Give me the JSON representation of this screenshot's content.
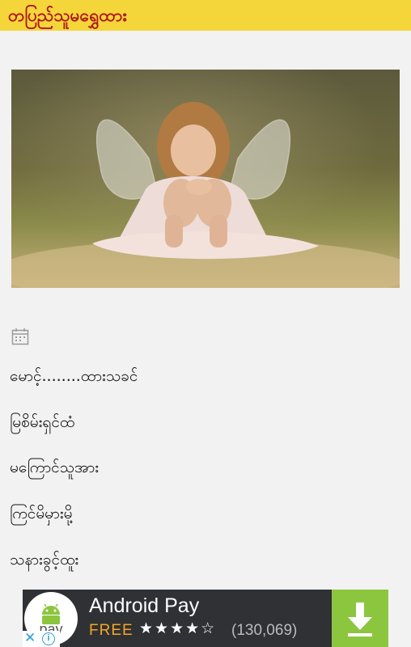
{
  "header": {
    "title": "တပြည်သူမရွှေထား"
  },
  "post": {
    "lines": [
      "မောင့်........ထားသခင်",
      "မြစိမ်းရှင်ထံ",
      "မကြောင်သူအား",
      "ကြင်မိမှားမို့",
      "သနားခွင့်ထူး"
    ]
  },
  "ad": {
    "logo_text": "pay",
    "app_name": "Android Pay",
    "price": "FREE",
    "rating_stars": "★★★★☆",
    "rating_count": "(130,069)",
    "colors": {
      "background": "#2f3135",
      "price": "#f5a623",
      "download": "#8cc63f"
    }
  },
  "adchoices": {
    "close": "✕",
    "info": "i"
  },
  "colors": {
    "header_bg": "#f5d63a",
    "header_text": "#b0151b"
  }
}
